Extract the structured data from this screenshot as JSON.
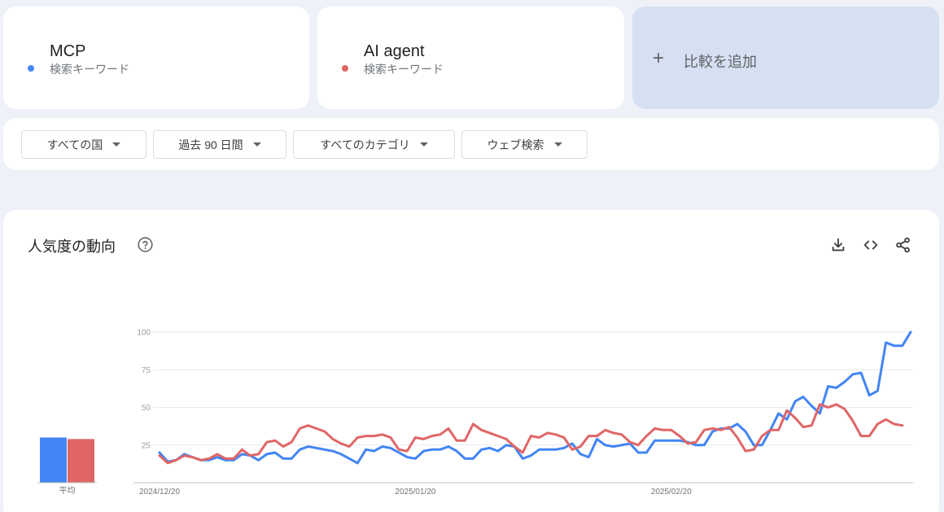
{
  "terms": [
    {
      "name": "MCP",
      "type": "検索キーワード",
      "color": "#4285f4"
    },
    {
      "name": "AI agent",
      "type": "検索キーワード",
      "color": "#e06666"
    }
  ],
  "add_compare": {
    "icon": "plus-icon",
    "label": "比較を追加"
  },
  "filters": [
    {
      "label": "すべての国"
    },
    {
      "label": "過去 90 日間"
    },
    {
      "label": "すべてのカテゴリ"
    },
    {
      "label": "ウェブ検索"
    }
  ],
  "panel": {
    "title": "人気度の動向",
    "icons": [
      "help-icon",
      "download-icon",
      "embed-code-icon",
      "share-icon"
    ]
  },
  "chart_data": {
    "type": "line",
    "title": "",
    "ylim": [
      0,
      100
    ],
    "yticks": [
      "25",
      "50",
      "75",
      "100"
    ],
    "x_tick_labels": [
      {
        "index": 0,
        "label": "2024/12/20"
      },
      {
        "index": 31,
        "label": "2025/01/20"
      },
      {
        "index": 62,
        "label": "2025/02/20"
      }
    ],
    "series": [
      {
        "name": "MCP",
        "color": "#4285f4",
        "values": [
          20,
          14,
          15,
          19,
          17,
          15,
          15,
          17,
          15,
          15,
          19,
          18,
          15,
          19,
          20,
          16,
          16,
          22,
          24,
          23,
          22,
          21,
          19,
          16,
          13,
          22,
          21,
          24,
          23,
          20,
          17,
          16,
          21,
          22,
          22,
          24,
          21,
          16,
          16,
          22,
          23,
          21,
          25,
          24,
          16,
          18,
          22,
          22,
          22,
          23,
          26,
          19,
          17,
          29,
          25,
          24,
          25,
          26,
          20,
          20,
          28,
          28,
          28,
          28,
          27,
          25,
          25,
          34,
          36,
          36,
          39,
          34,
          25,
          25,
          35,
          46,
          42,
          54,
          57,
          51,
          46,
          64,
          63,
          67,
          72,
          73,
          58,
          61,
          93,
          91,
          91,
          100
        ]
      },
      {
        "name": "AI agent",
        "color": "#e06666",
        "values": [
          18,
          13,
          15,
          18,
          17,
          15,
          16,
          19,
          16,
          16,
          22,
          18,
          19,
          27,
          28,
          24,
          27,
          36,
          38,
          36,
          34,
          29,
          26,
          24,
          30,
          31,
          31,
          32,
          30,
          22,
          21,
          30,
          29,
          31,
          32,
          36,
          28,
          28,
          39,
          35,
          33,
          31,
          29,
          24,
          20,
          31,
          30,
          33,
          32,
          30,
          22,
          24,
          31,
          31,
          35,
          33,
          32,
          27,
          25,
          31,
          36,
          35,
          35,
          31,
          26,
          27,
          35,
          36,
          35,
          37,
          30,
          21,
          22,
          31,
          35,
          35,
          48,
          43,
          37,
          38,
          52,
          50,
          52,
          49,
          41,
          31,
          31,
          39,
          42,
          39,
          38
        ]
      }
    ],
    "averages": {
      "label": "平均",
      "values": [
        30,
        29
      ]
    }
  }
}
